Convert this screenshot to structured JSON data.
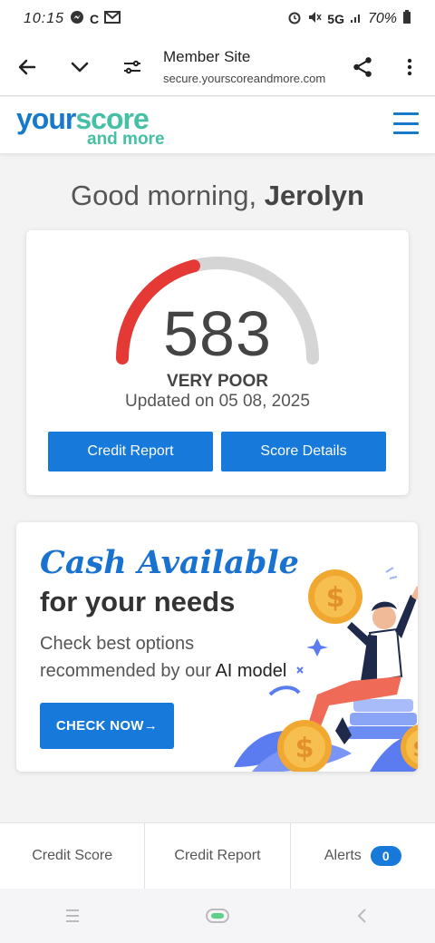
{
  "status_bar": {
    "time": "10:15",
    "left_icons": [
      "messenger-icon",
      "c-icon",
      "gmail-icon"
    ],
    "network": "5G",
    "battery": "70%"
  },
  "browser": {
    "title": "Member Site",
    "url": "secure.yourscoreandmore.com"
  },
  "header": {
    "logo_part1": "your",
    "logo_part2": "score",
    "logo_part3": "and more"
  },
  "greeting": {
    "prefix": "Good morning,",
    "name": "Jerolyn"
  },
  "score": {
    "value": "583",
    "rating": "VERY POOR",
    "updated": "Updated on 05 08, 2025",
    "gauge_fraction": 0.42,
    "colors": {
      "filled": "#e53935",
      "track": "#d5d5d5"
    },
    "buttons": {
      "report": "Credit Report",
      "details": "Score Details"
    }
  },
  "promo": {
    "headline": "Cash Available",
    "subhead": "for your needs",
    "line1": "Check best options",
    "line2_prefix": "recommended by our",
    "line2_suffix": "AI model",
    "cta": "CHECK NOW→"
  },
  "tabs": [
    {
      "label": "Credit Score"
    },
    {
      "label": "Credit Report"
    },
    {
      "label": "Alerts",
      "badge": "0"
    }
  ],
  "colors": {
    "brand_blue": "#1779d9",
    "brand_green": "#45c0a4",
    "gauge_red": "#e53935"
  }
}
